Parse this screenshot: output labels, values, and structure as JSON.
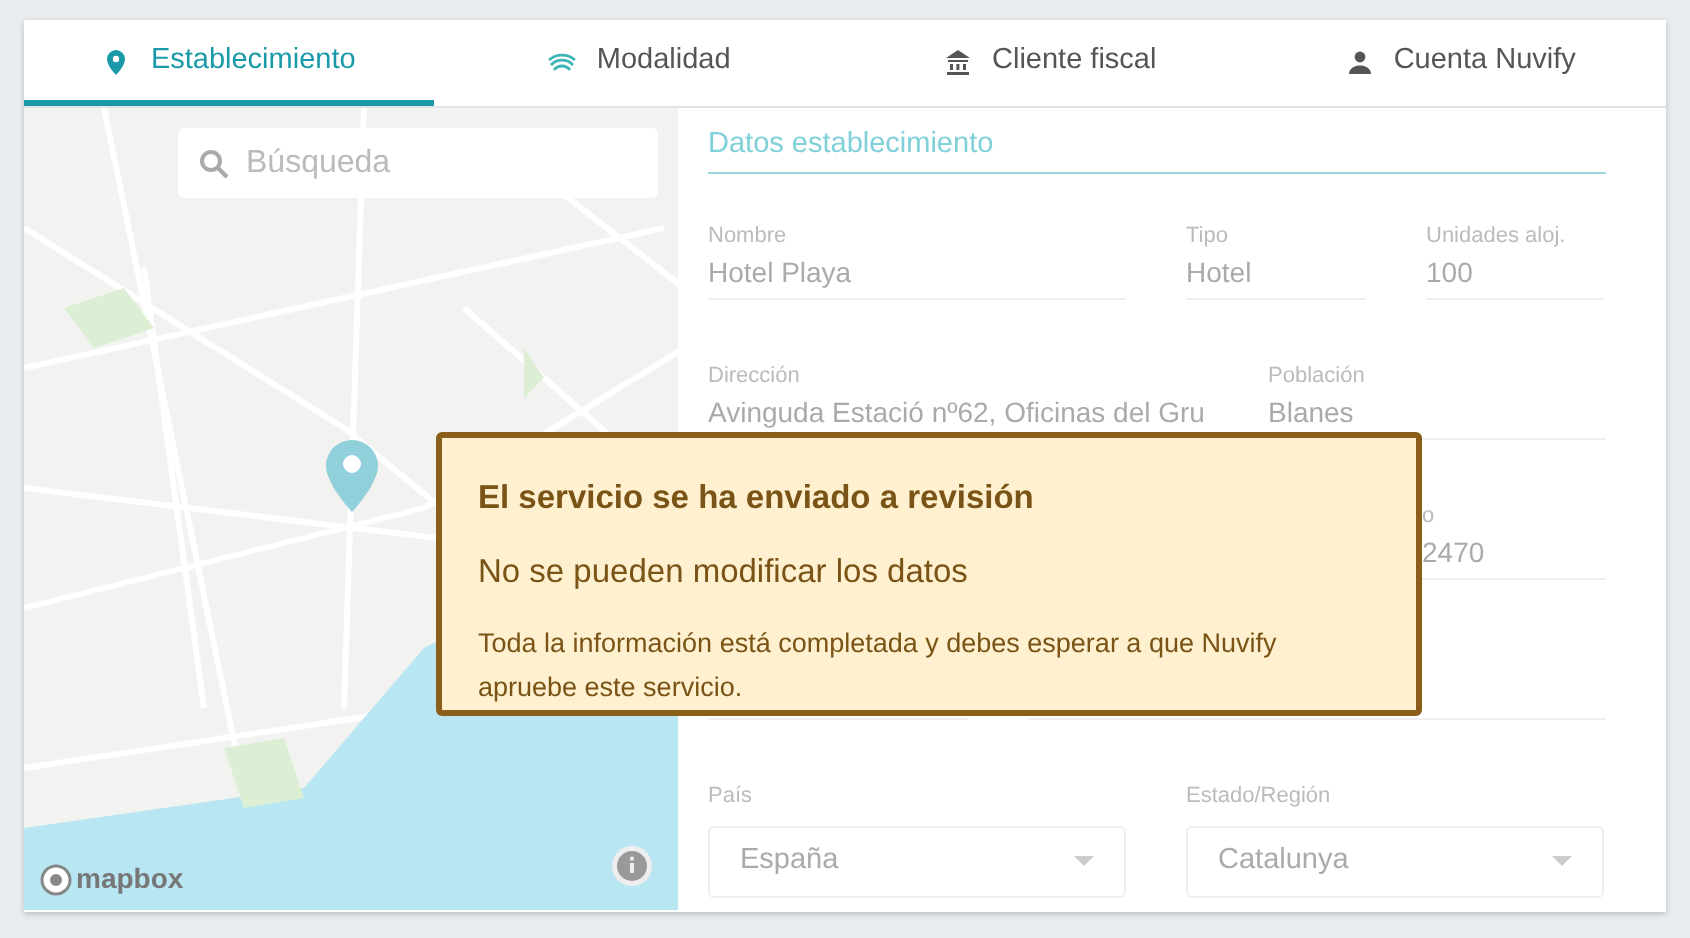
{
  "tabs": [
    {
      "label": "Establecimiento",
      "selected": true
    },
    {
      "label": "Modalidad",
      "selected": false
    },
    {
      "label": "Cliente fiscal",
      "selected": false
    },
    {
      "label": "Cuenta Nuvify",
      "selected": false
    }
  ],
  "map": {
    "search": {
      "placeholder": "Búsqueda"
    },
    "attribution": "mapbox"
  },
  "form": {
    "section_title": "Datos establecimiento",
    "rows": [
      [
        {
          "kind": "text",
          "label": "Nombre",
          "value": "Hotel Playa"
        },
        {
          "kind": "text",
          "label": "Tipo",
          "value": "Hotel"
        },
        {
          "kind": "text",
          "label": "Unidades aloj.",
          "value": "100"
        }
      ],
      [
        {
          "kind": "text",
          "label": "Dirección",
          "value": "Avinguda Estació nº62, Oficinas del Gru"
        },
        {
          "kind": "text",
          "label": "Población",
          "value": "Blanes"
        }
      ],
      [
        {
          "kind": "select",
          "label": "País",
          "value": "España"
        },
        {
          "kind": "select",
          "label": "Estado/Región",
          "value": "Catalunya"
        }
      ]
    ]
  },
  "partial_field": {
    "label": "o",
    "value": "2470"
  },
  "notice": {
    "title": "El servicio se ha enviado a revisión",
    "subtitle": "No se pueden modificar los datos",
    "body": "Toda la información está completada y debes esperar a que Nuvify apruebe este servicio."
  }
}
